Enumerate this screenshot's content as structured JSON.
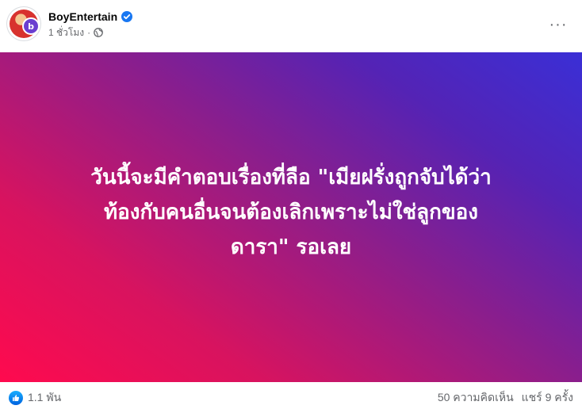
{
  "post": {
    "author": "BoyEntertain",
    "time": "1 ชั่วโมง",
    "separator": "·",
    "audience_icon": "globe-icon",
    "verified_icon": "verified-badge-icon",
    "more_icon": "more-options-icon",
    "more_label": "···",
    "avatar_badge": "b",
    "text_lines": [
      "วันนี้จะมีคำตอบเรื่องที่ลือ \"เมียฝรั่งถูกจับได้ว่า",
      "ท้องกับคนอื่นจนต้องเลิกเพราะไม่ใช่ลูกของ",
      "ดารา\" รอเลย"
    ],
    "background_colors": [
      "#ff0a4e",
      "#8b1e8c",
      "#3a2fd6"
    ]
  },
  "footer": {
    "reaction_icon": "like-icon",
    "reactions": "1.1 พัน",
    "comments": "50 ความคิดเห็น",
    "shares": "แชร์ 9 ครั้ง"
  }
}
